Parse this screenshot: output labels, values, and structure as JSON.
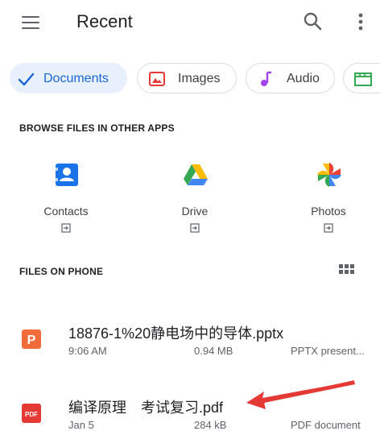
{
  "header": {
    "title": "Recent",
    "menu_icon": "hamburger-menu-icon",
    "search_icon": "search-icon",
    "more_icon": "more-vert-icon"
  },
  "chips": [
    {
      "label": "Documents",
      "icon": "check-icon",
      "selected": true
    },
    {
      "label": "Images",
      "icon": "image-icon",
      "selected": false
    },
    {
      "label": "Audio",
      "icon": "music-note-icon",
      "selected": false
    },
    {
      "label": "",
      "icon": "video-icon",
      "selected": false
    }
  ],
  "browse_section": {
    "title": "BROWSE FILES IN OTHER APPS",
    "apps": [
      {
        "label": "Contacts",
        "icon": "contacts-icon"
      },
      {
        "label": "Drive",
        "icon": "drive-icon"
      },
      {
        "label": "Photos",
        "icon": "photos-icon"
      }
    ]
  },
  "files_section": {
    "title": "FILES ON PHONE",
    "view_toggle_icon": "grid-view-icon",
    "files": [
      {
        "name": "18876-1%20静电场中的导体.pptx",
        "date": "9:06 AM",
        "size": "0.94 MB",
        "type": "PPTX present...",
        "icon": "pptx-file-icon",
        "icon_color": "#f26b3a"
      },
      {
        "name": "编译原理　考试复习.pdf",
        "date": "Jan 5",
        "size": "284 kB",
        "type": "PDF document",
        "icon": "pdf-file-icon",
        "icon_color": "#e53935"
      }
    ]
  },
  "colors": {
    "accent": "#1967d2",
    "chip_selected_bg": "#e8f0fe",
    "annotation_arrow": "#e53935"
  }
}
